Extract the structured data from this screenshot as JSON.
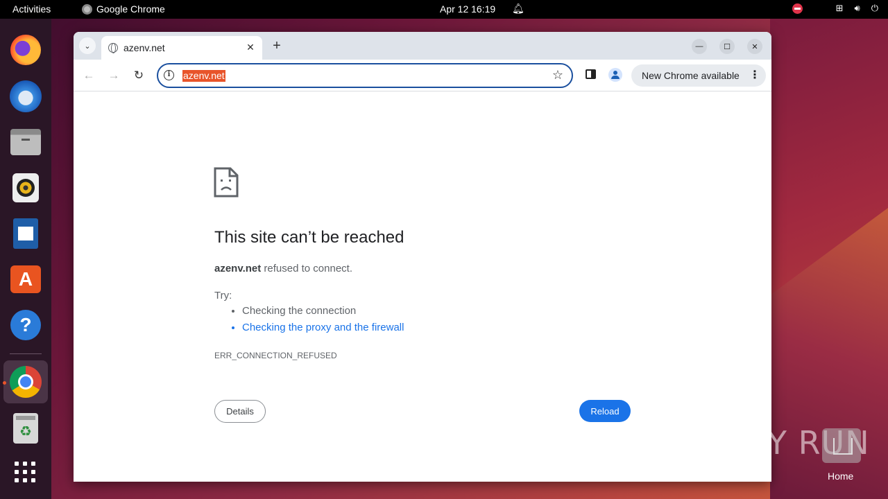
{
  "topbar": {
    "activities": "Activities",
    "app_name": "Google Chrome",
    "clock": "Apr 12  16:19"
  },
  "dock": {
    "items": [
      "firefox-icon",
      "thunderbird-icon",
      "files-icon",
      "rhythmbox-icon",
      "libreoffice-writer-icon",
      "app-center-icon",
      "help-icon",
      "chrome-icon",
      "trash-icon",
      "show-apps-icon"
    ]
  },
  "browser": {
    "tab_title": "azenv.net",
    "url": "azenv.net",
    "update_label": "New Chrome available"
  },
  "error_page": {
    "title": "This site can’t be reached",
    "host": "azenv.net",
    "desc_suffix": " refused to connect.",
    "try_label": "Try:",
    "suggestions": [
      "Checking the connection",
      "Checking the proxy and the firewall"
    ],
    "error_code": "ERR_CONNECTION_REFUSED",
    "details_label": "Details",
    "reload_label": "Reload"
  },
  "desktop": {
    "home_label": "Home",
    "watermark": "ANY RUN"
  },
  "colors": {
    "accent_blue": "#1a73e8",
    "url_highlight": "#e8542a",
    "omnibox_border": "#1a4f9e"
  }
}
